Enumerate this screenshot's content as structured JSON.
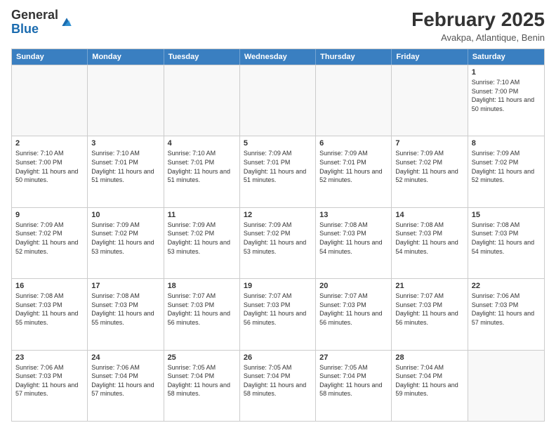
{
  "header": {
    "logo_general": "General",
    "logo_blue": "Blue",
    "month_title": "February 2025",
    "location": "Avakpa, Atlantique, Benin"
  },
  "weekdays": [
    "Sunday",
    "Monday",
    "Tuesday",
    "Wednesday",
    "Thursday",
    "Friday",
    "Saturday"
  ],
  "weeks": [
    [
      {
        "day": "",
        "text": ""
      },
      {
        "day": "",
        "text": ""
      },
      {
        "day": "",
        "text": ""
      },
      {
        "day": "",
        "text": ""
      },
      {
        "day": "",
        "text": ""
      },
      {
        "day": "",
        "text": ""
      },
      {
        "day": "1",
        "text": "Sunrise: 7:10 AM\nSunset: 7:00 PM\nDaylight: 11 hours\nand 50 minutes."
      }
    ],
    [
      {
        "day": "2",
        "text": "Sunrise: 7:10 AM\nSunset: 7:00 PM\nDaylight: 11 hours\nand 50 minutes."
      },
      {
        "day": "3",
        "text": "Sunrise: 7:10 AM\nSunset: 7:01 PM\nDaylight: 11 hours\nand 51 minutes."
      },
      {
        "day": "4",
        "text": "Sunrise: 7:10 AM\nSunset: 7:01 PM\nDaylight: 11 hours\nand 51 minutes."
      },
      {
        "day": "5",
        "text": "Sunrise: 7:09 AM\nSunset: 7:01 PM\nDaylight: 11 hours\nand 51 minutes."
      },
      {
        "day": "6",
        "text": "Sunrise: 7:09 AM\nSunset: 7:01 PM\nDaylight: 11 hours\nand 52 minutes."
      },
      {
        "day": "7",
        "text": "Sunrise: 7:09 AM\nSunset: 7:02 PM\nDaylight: 11 hours\nand 52 minutes."
      },
      {
        "day": "8",
        "text": "Sunrise: 7:09 AM\nSunset: 7:02 PM\nDaylight: 11 hours\nand 52 minutes."
      }
    ],
    [
      {
        "day": "9",
        "text": "Sunrise: 7:09 AM\nSunset: 7:02 PM\nDaylight: 11 hours\nand 52 minutes."
      },
      {
        "day": "10",
        "text": "Sunrise: 7:09 AM\nSunset: 7:02 PM\nDaylight: 11 hours\nand 53 minutes."
      },
      {
        "day": "11",
        "text": "Sunrise: 7:09 AM\nSunset: 7:02 PM\nDaylight: 11 hours\nand 53 minutes."
      },
      {
        "day": "12",
        "text": "Sunrise: 7:09 AM\nSunset: 7:02 PM\nDaylight: 11 hours\nand 53 minutes."
      },
      {
        "day": "13",
        "text": "Sunrise: 7:08 AM\nSunset: 7:03 PM\nDaylight: 11 hours\nand 54 minutes."
      },
      {
        "day": "14",
        "text": "Sunrise: 7:08 AM\nSunset: 7:03 PM\nDaylight: 11 hours\nand 54 minutes."
      },
      {
        "day": "15",
        "text": "Sunrise: 7:08 AM\nSunset: 7:03 PM\nDaylight: 11 hours\nand 54 minutes."
      }
    ],
    [
      {
        "day": "16",
        "text": "Sunrise: 7:08 AM\nSunset: 7:03 PM\nDaylight: 11 hours\nand 55 minutes."
      },
      {
        "day": "17",
        "text": "Sunrise: 7:08 AM\nSunset: 7:03 PM\nDaylight: 11 hours\nand 55 minutes."
      },
      {
        "day": "18",
        "text": "Sunrise: 7:07 AM\nSunset: 7:03 PM\nDaylight: 11 hours\nand 56 minutes."
      },
      {
        "day": "19",
        "text": "Sunrise: 7:07 AM\nSunset: 7:03 PM\nDaylight: 11 hours\nand 56 minutes."
      },
      {
        "day": "20",
        "text": "Sunrise: 7:07 AM\nSunset: 7:03 PM\nDaylight: 11 hours\nand 56 minutes."
      },
      {
        "day": "21",
        "text": "Sunrise: 7:07 AM\nSunset: 7:03 PM\nDaylight: 11 hours\nand 56 minutes."
      },
      {
        "day": "22",
        "text": "Sunrise: 7:06 AM\nSunset: 7:03 PM\nDaylight: 11 hours\nand 57 minutes."
      }
    ],
    [
      {
        "day": "23",
        "text": "Sunrise: 7:06 AM\nSunset: 7:03 PM\nDaylight: 11 hours\nand 57 minutes."
      },
      {
        "day": "24",
        "text": "Sunrise: 7:06 AM\nSunset: 7:04 PM\nDaylight: 11 hours\nand 57 minutes."
      },
      {
        "day": "25",
        "text": "Sunrise: 7:05 AM\nSunset: 7:04 PM\nDaylight: 11 hours\nand 58 minutes."
      },
      {
        "day": "26",
        "text": "Sunrise: 7:05 AM\nSunset: 7:04 PM\nDaylight: 11 hours\nand 58 minutes."
      },
      {
        "day": "27",
        "text": "Sunrise: 7:05 AM\nSunset: 7:04 PM\nDaylight: 11 hours\nand 58 minutes."
      },
      {
        "day": "28",
        "text": "Sunrise: 7:04 AM\nSunset: 7:04 PM\nDaylight: 11 hours\nand 59 minutes."
      },
      {
        "day": "",
        "text": ""
      }
    ]
  ]
}
